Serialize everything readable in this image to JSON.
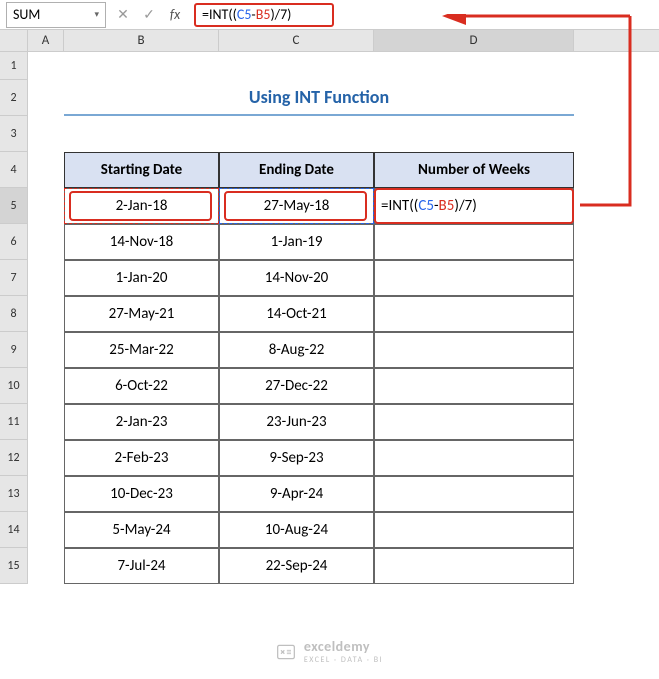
{
  "nameBox": "SUM",
  "formulaBar": {
    "raw": "=INT((C5-B5)/7)",
    "prefix": "=INT((",
    "ref1": "C5",
    "dash": "-",
    "ref2": "B5",
    "suffix": ")/7)"
  },
  "columns": {
    "A": "A",
    "B": "B",
    "C": "C",
    "D": "D"
  },
  "rows": [
    "1",
    "2",
    "3",
    "4",
    "5",
    "6",
    "7",
    "8",
    "9",
    "10",
    "11",
    "12",
    "13",
    "14",
    "15"
  ],
  "title": "Using INT Function",
  "headers": {
    "b": "Starting Date",
    "c": "Ending Date",
    "d": "Number of Weeks"
  },
  "data": [
    {
      "b": "2-Jan-18",
      "c": "27-May-18"
    },
    {
      "b": "14-Nov-18",
      "c": "1-Jan-19"
    },
    {
      "b": "1-Jan-20",
      "c": "14-Nov-20"
    },
    {
      "b": "27-May-21",
      "c": "14-Oct-21"
    },
    {
      "b": "25-Mar-22",
      "c": "8-Aug-22"
    },
    {
      "b": "6-Oct-22",
      "c": "27-Dec-22"
    },
    {
      "b": "2-Jan-23",
      "c": "23-Jun-23"
    },
    {
      "b": "2-Feb-23",
      "c": "9-Sep-23"
    },
    {
      "b": "10-Dec-23",
      "c": "9-Apr-24"
    },
    {
      "b": "5-May-24",
      "c": "10-Aug-24"
    },
    {
      "b": "7-Jul-24",
      "c": "22-Sep-24"
    }
  ],
  "d5": {
    "prefix": "=INT((",
    "ref1": "C5",
    "dash": "-",
    "ref2": "B5",
    "suffix": ")/7)"
  },
  "watermark": {
    "name": "exceldemy",
    "sub": "EXCEL · DATA · BI"
  }
}
